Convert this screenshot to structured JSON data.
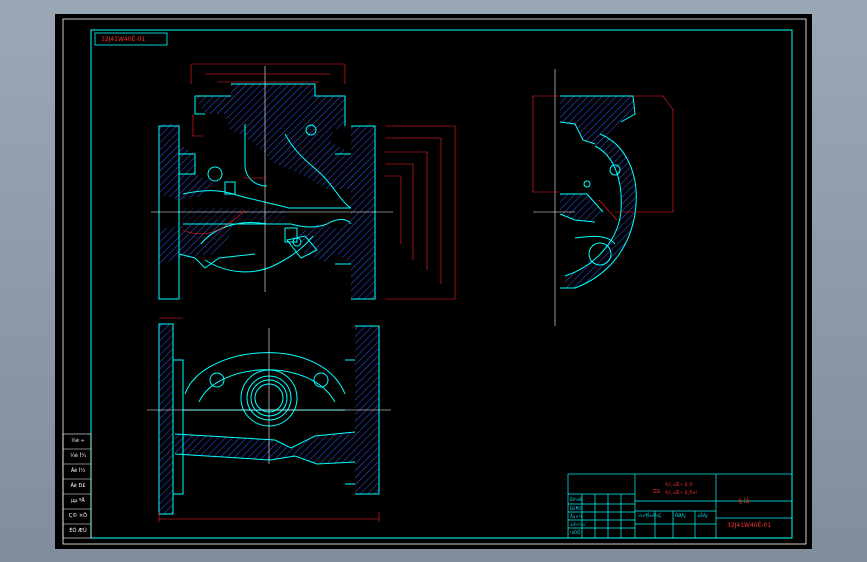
{
  "drawing": {
    "code_top": "32J41W40Ê-01",
    "code_bottom": "32J41W40Ê-01",
    "material_line1": "ZG",
    "material_line2a": "Ä¡Ï¸±ÎÊ÷¸ß¸Ö",
    "material_line2b": "Ä¡Ï¸±ÎÊ÷¸ß¸Ö±ì",
    "part_name": "·§  Ìå"
  },
  "side_labels": [
    "½è ÷",
    "½è Í¼",
    "Ãè Í¼",
    "Ãè Ð£",
    "µµ ºÅ",
    "Ç© ×Ö",
    "ÈÕ ÆÚ"
  ],
  "title_block": {
    "designer": "Éè¼Æ",
    "checker": "Ð£¶Ô",
    "approver": "Åú×¼",
    "standard": "±ê×¼»¯",
    "craft": "¹¤ÒÕ",
    "ratio_label": "±ÈÀý",
    "weight_label": "ÖØÁ¿",
    "stage_label": "½×¶Î±ê¼Ç"
  },
  "colors": {
    "background": "#000000",
    "outline": "#00ffff",
    "dimension": "#ff2020",
    "hatch": "#3060ff",
    "centerline": "#ffffff"
  }
}
